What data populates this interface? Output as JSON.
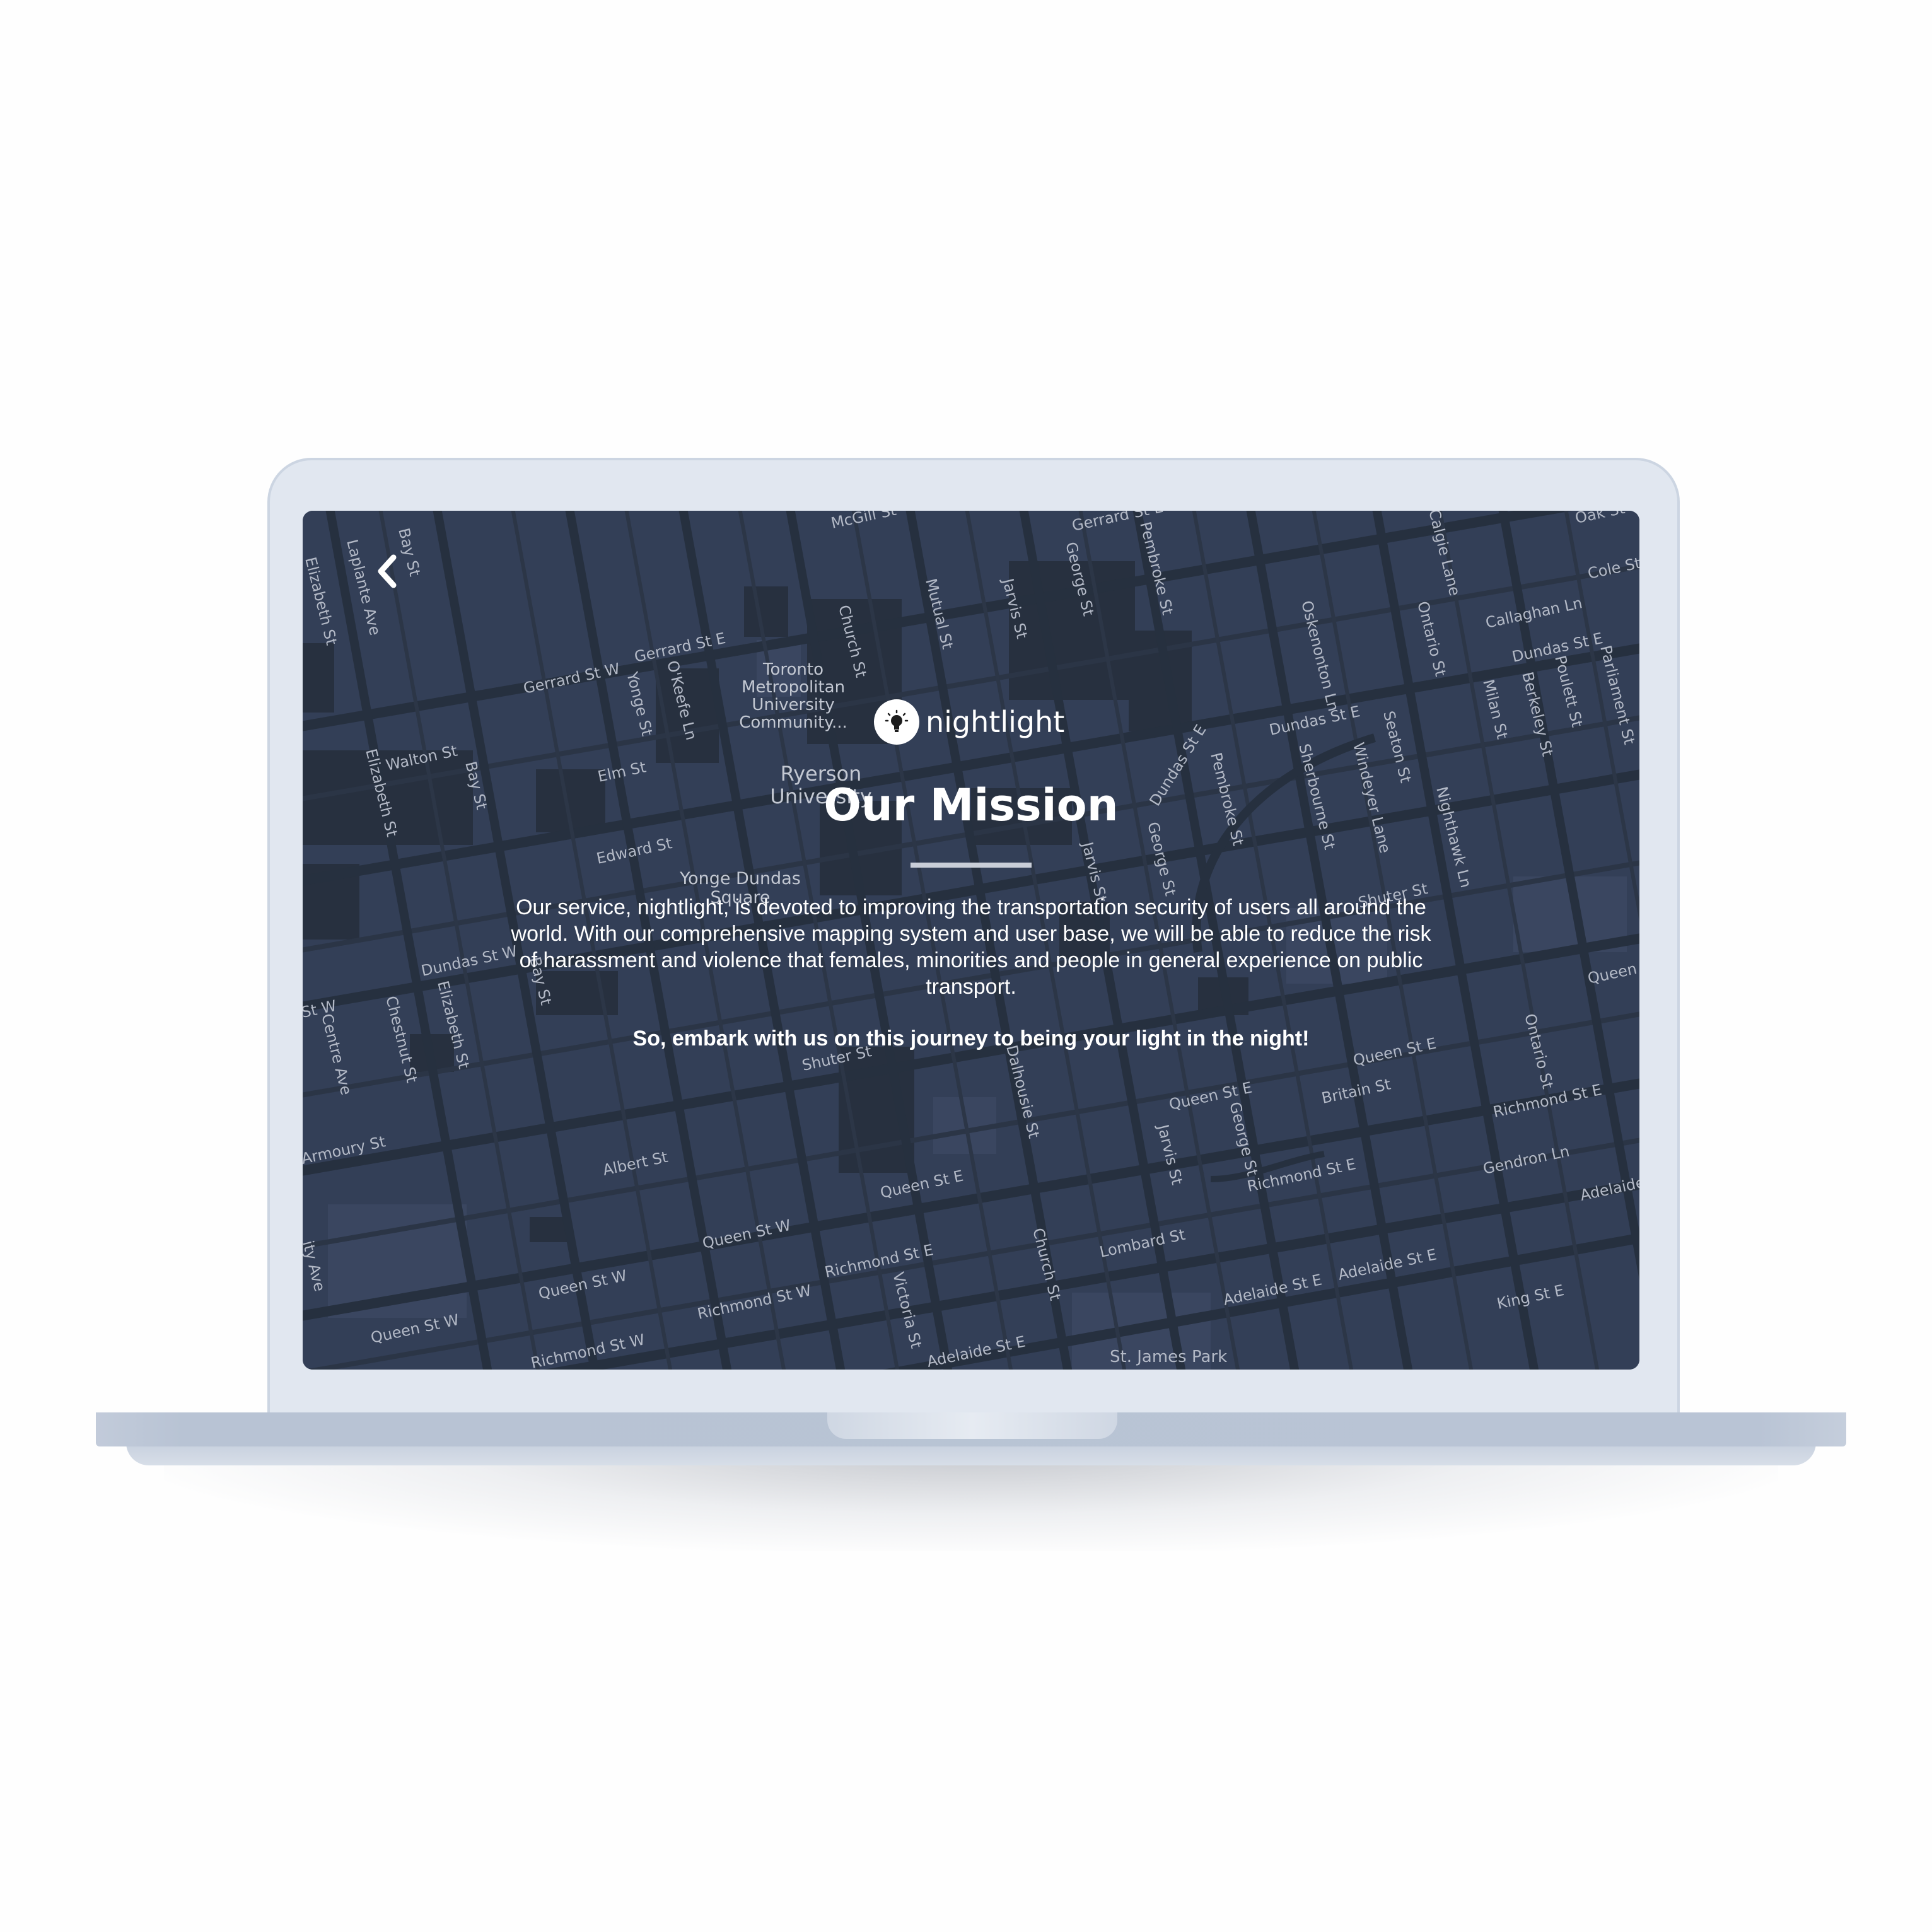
{
  "app": {
    "logo_text": "nightlight",
    "title": "Our Mission",
    "body": "Our service, nightlight, is devoted to improving the transportation security of users all around the world. With our comprehensive mapping system and user base, we will be able to reduce the risk of harassment and violence that females, minorities and people in general experience on public transport.",
    "tagline": "So, embark with us on this journey to being your light in the night!"
  },
  "icons": {
    "back": "chevron-left-icon",
    "logo": "lightbulb-icon"
  },
  "colors": {
    "map_background": "#333f57",
    "map_block_dark": "#27303f",
    "map_road": "#26303f",
    "text": "#ffffff",
    "laptop_lid": "#e1e7f0",
    "laptop_base": "#b8c3d4"
  },
  "map_labels": {
    "mcgill": "McGill St",
    "gerrard_e_top": "Gerrard St E",
    "pembroke_top": "Pembroke St",
    "george_top": "George St",
    "jarvis_top": "Jarvis St",
    "mutual_top": "Mutual St",
    "church_top": "Church St",
    "bay_top": "Bay St",
    "elizabeth_top": "Elizabeth St",
    "laplante": "Laplante Ave",
    "gerrard_w": "Gerrard St W",
    "gerrard_e": "Gerrard St E",
    "yonge": "Yonge St",
    "okeefe": "O'Keefe Ln",
    "tmu_1": "Toronto",
    "tmu_2": "Metropolitan",
    "tmu_3": "University",
    "tmu_4": "Community...",
    "ryerson_1": "Ryerson",
    "ryerson_2": "University",
    "walton": "Walton St",
    "elizabeth_mid": "Elizabeth St",
    "bay_mid": "Bay St",
    "elm": "Elm St",
    "edward": "Edward St",
    "yonge_dundas_1": "Yonge Dundas",
    "yonge_dundas_2": "Square",
    "dundas_w": "Dundas St W",
    "dundas_e_mid": "Dundas St E",
    "dundas_e_right": "Dundas St E",
    "dundas_e_far": "Dundas St E",
    "dundas_e_curve": "Dundas St E",
    "oskenonton": "Oskenonton Ln",
    "ontario_top": "Ontario St",
    "calgie": "Calgie Lane",
    "callaghan": "Callaghan Ln",
    "cole": "Cole St",
    "oak": "Oak St",
    "parliament": "Parliament St",
    "poulett": "Poulett St",
    "berkeley": "Berkeley St",
    "milan": "Milan St",
    "seaton": "Seaton St",
    "windeyer": "Windeyer Lane",
    "nighthawk": "Nighthawk Ln",
    "sherbourne": "Sherbourne St",
    "pembroke_mid": "Pembroke St",
    "george_mid": "George St",
    "jarvis_mid": "Jarvis St",
    "shuter_right": "Shuter St",
    "shuter_mid": "Shuter St",
    "queen_far_right": "Queen S",
    "st_w": "St W",
    "centre": "Centre Ave",
    "chestnut": "Chestnut St",
    "elizabeth_low": "Elizabeth St",
    "bay_low": "Bay St",
    "dalhousie": "Dalhousie St",
    "ontario_low": "Ontario St",
    "queen_e_right": "Queen St E",
    "queen_e_mid": "Queen St E",
    "richmond_e_right": "Richmond St E",
    "britain": "Britain St",
    "jarvis_low": "Jarvis St",
    "george_low": "George St",
    "richmond_e_mid": "Richmond St E",
    "gendron": "Gendron Ln",
    "adelaide_right": "Adelaide",
    "armoury": "Armoury St",
    "albert": "Albert St",
    "queen_e_low": "Queen St E",
    "queen_w_1": "Queen St W",
    "queen_w_2": "Queen St W",
    "queen_w_3": "Queen St W",
    "richmond_e_low": "Richmond St E",
    "richmond_w_1": "Richmond St W",
    "richmond_w_2": "Richmond St W",
    "church_low": "Church St",
    "lombard": "Lombard St",
    "victoria": "Victoria St",
    "adelaide_e_1": "Adelaide St E",
    "adelaide_e_2": "Adelaide St E",
    "adelaide_e_3": "Adelaide St E",
    "king_e": "King St E",
    "st_james": "St. James Park",
    "university_ave": "ity Ave"
  }
}
